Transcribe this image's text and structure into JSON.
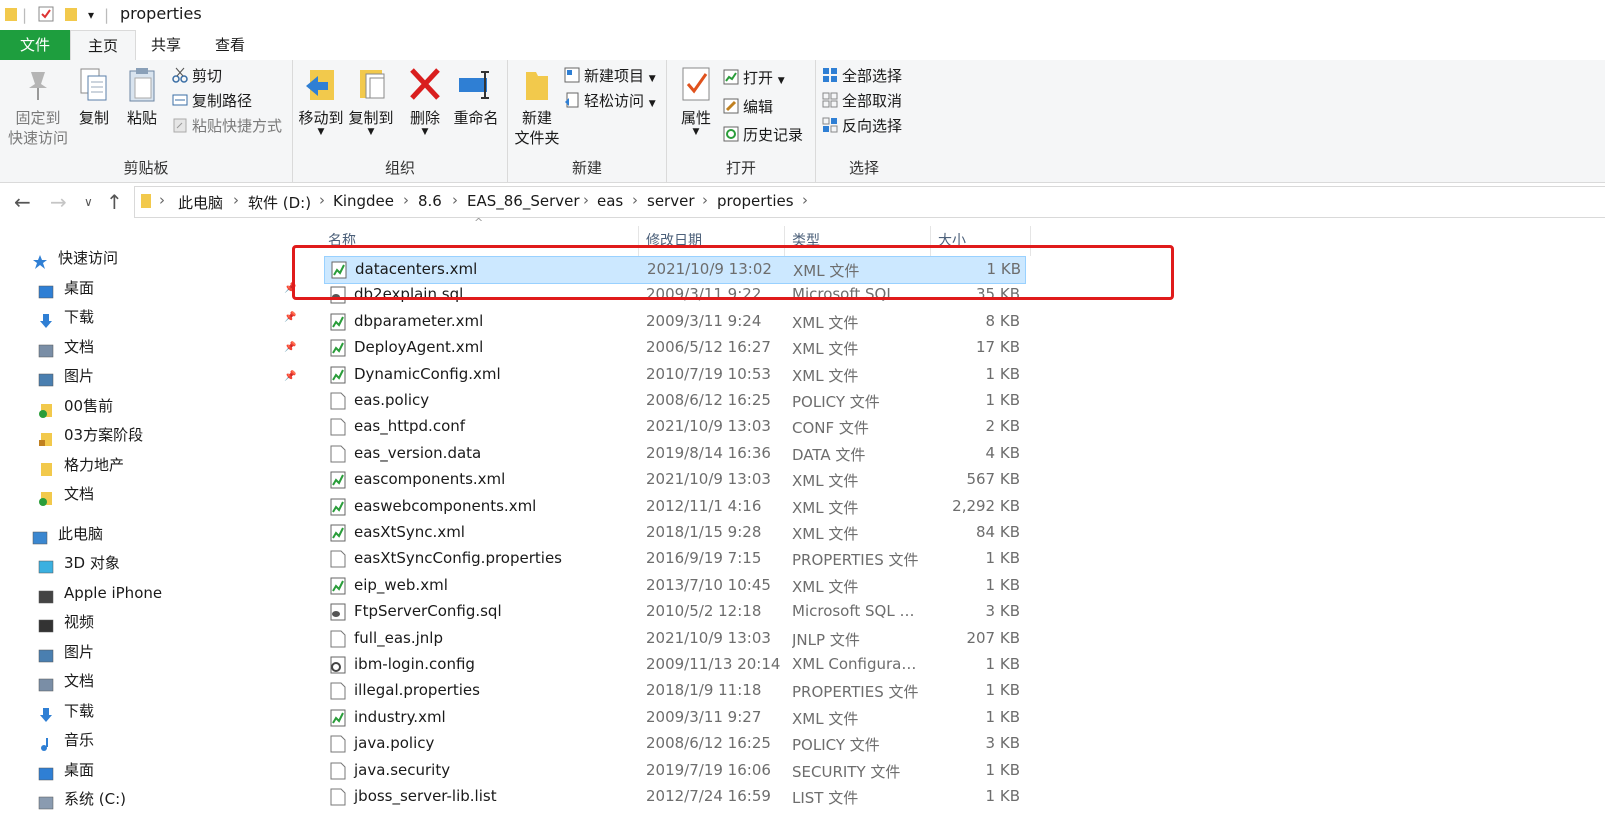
{
  "window": {
    "title": "properties"
  },
  "tabs": {
    "file": "文件",
    "home": "主页",
    "share": "共享",
    "view": "查看"
  },
  "ribbon": {
    "clipboard": {
      "label": "剪贴板",
      "pin": "固定到\n快速访问",
      "copy": "复制",
      "paste": "粘贴",
      "cut": "剪切",
      "copy_path": "复制路径",
      "paste_shortcut": "粘贴快捷方式"
    },
    "organize": {
      "label": "组织",
      "move_to": "移动到",
      "copy_to": "复制到",
      "delete": "删除",
      "rename": "重命名"
    },
    "new": {
      "label": "新建",
      "new_folder": "新建\n文件夹",
      "new_item": "新建项目",
      "easy_access": "轻松访问"
    },
    "open": {
      "label": "打开",
      "properties": "属性",
      "open": "打开",
      "edit": "编辑",
      "history": "历史记录"
    },
    "select": {
      "label": "选择",
      "select_all": "全部选择",
      "select_none": "全部取消",
      "invert": "反向选择"
    }
  },
  "address": {
    "crumbs": [
      "此电脑",
      "软件 (D:)",
      "Kingdee",
      "8.6",
      "EAS_86_Server",
      "eas",
      "server",
      "properties"
    ]
  },
  "nav": {
    "items": [
      {
        "label": "快速访问",
        "icon": "star-icon",
        "indent": 0,
        "pinned": false
      },
      {
        "label": "桌面",
        "icon": "desktop-icon",
        "indent": 1,
        "pinned": true
      },
      {
        "label": "下载",
        "icon": "download-icon",
        "indent": 1,
        "pinned": true
      },
      {
        "label": "文档",
        "icon": "document-icon",
        "indent": 1,
        "pinned": true
      },
      {
        "label": "图片",
        "icon": "picture-icon",
        "indent": 1,
        "pinned": true
      },
      {
        "label": "00售前",
        "icon": "synced-folder-icon",
        "indent": 1,
        "pinned": false
      },
      {
        "label": "03方案阶段",
        "icon": "lock-folder-icon",
        "indent": 1,
        "pinned": false
      },
      {
        "label": "格力地产",
        "icon": "folder-icon",
        "indent": 1,
        "pinned": false
      },
      {
        "label": "文档",
        "icon": "synced-folder-icon",
        "indent": 1,
        "pinned": false
      },
      {
        "label": "此电脑",
        "icon": "computer-icon",
        "indent": 0,
        "pinned": false
      },
      {
        "label": "3D 对象",
        "icon": "3d-objects-icon",
        "indent": 1,
        "pinned": false
      },
      {
        "label": "Apple iPhone",
        "icon": "phone-icon",
        "indent": 1,
        "pinned": false
      },
      {
        "label": "视频",
        "icon": "video-icon",
        "indent": 1,
        "pinned": false
      },
      {
        "label": "图片",
        "icon": "picture-icon",
        "indent": 1,
        "pinned": false
      },
      {
        "label": "文档",
        "icon": "document-icon",
        "indent": 1,
        "pinned": false
      },
      {
        "label": "下载",
        "icon": "download-icon",
        "indent": 1,
        "pinned": false
      },
      {
        "label": "音乐",
        "icon": "music-icon",
        "indent": 1,
        "pinned": false
      },
      {
        "label": "桌面",
        "icon": "desktop-icon",
        "indent": 1,
        "pinned": false
      },
      {
        "label": "系统 (C:)",
        "icon": "drive-icon",
        "indent": 1,
        "pinned": false
      }
    ]
  },
  "columns": {
    "name": "名称",
    "date": "修改日期",
    "type": "类型",
    "size": "大小"
  },
  "files": [
    {
      "name": "datacenters.xml",
      "date": "2021/10/9 13:02",
      "type": "XML 文件",
      "size": "1 KB",
      "kind": "xml",
      "selected": true
    },
    {
      "name": "db2explain.sql",
      "date": "2009/3/11 9:22",
      "type": "Microsoft SQL S...",
      "size": "35 KB",
      "kind": "sql"
    },
    {
      "name": "dbparameter.xml",
      "date": "2009/3/11 9:24",
      "type": "XML 文件",
      "size": "8 KB",
      "kind": "xml"
    },
    {
      "name": "DeployAgent.xml",
      "date": "2006/5/12 16:27",
      "type": "XML 文件",
      "size": "17 KB",
      "kind": "xml"
    },
    {
      "name": "DynamicConfig.xml",
      "date": "2010/7/19 10:53",
      "type": "XML 文件",
      "size": "1 KB",
      "kind": "xml"
    },
    {
      "name": "eas.policy",
      "date": "2008/6/12 16:25",
      "type": "POLICY 文件",
      "size": "1 KB",
      "kind": "file"
    },
    {
      "name": "eas_httpd.conf",
      "date": "2021/10/9 13:03",
      "type": "CONF 文件",
      "size": "2 KB",
      "kind": "file"
    },
    {
      "name": "eas_version.data",
      "date": "2019/8/14 16:36",
      "type": "DATA 文件",
      "size": "4 KB",
      "kind": "file"
    },
    {
      "name": "eascomponents.xml",
      "date": "2021/10/9 13:03",
      "type": "XML 文件",
      "size": "567 KB",
      "kind": "xml"
    },
    {
      "name": "easwebcomponents.xml",
      "date": "2012/11/1 4:16",
      "type": "XML 文件",
      "size": "2,292 KB",
      "kind": "xml"
    },
    {
      "name": "easXtSync.xml",
      "date": "2018/1/15 9:28",
      "type": "XML 文件",
      "size": "84 KB",
      "kind": "xml"
    },
    {
      "name": "easXtSyncConfig.properties",
      "date": "2016/9/19 7:15",
      "type": "PROPERTIES 文件",
      "size": "1 KB",
      "kind": "file"
    },
    {
      "name": "eip_web.xml",
      "date": "2013/7/10 10:45",
      "type": "XML 文件",
      "size": "1 KB",
      "kind": "xml"
    },
    {
      "name": "FtpServerConfig.sql",
      "date": "2010/5/2 12:18",
      "type": "Microsoft SQL S...",
      "size": "3 KB",
      "kind": "sql"
    },
    {
      "name": "full_eas.jnlp",
      "date": "2021/10/9 13:03",
      "type": "JNLP 文件",
      "size": "207 KB",
      "kind": "file"
    },
    {
      "name": "ibm-login.config",
      "date": "2009/11/13 20:14",
      "type": "XML Configurati...",
      "size": "1 KB",
      "kind": "config"
    },
    {
      "name": "illegal.properties",
      "date": "2018/1/9 11:18",
      "type": "PROPERTIES 文件",
      "size": "1 KB",
      "kind": "file"
    },
    {
      "name": "industry.xml",
      "date": "2009/3/11 9:27",
      "type": "XML 文件",
      "size": "1 KB",
      "kind": "xml"
    },
    {
      "name": "java.policy",
      "date": "2008/6/12 16:25",
      "type": "POLICY 文件",
      "size": "3 KB",
      "kind": "file"
    },
    {
      "name": "java.security",
      "date": "2019/7/19 16:06",
      "type": "SECURITY 文件",
      "size": "1 KB",
      "kind": "file"
    },
    {
      "name": "jboss_server-lib.list",
      "date": "2012/7/24 16:59",
      "type": "LIST 文件",
      "size": "1 KB",
      "kind": "file"
    }
  ],
  "colors": {
    "file_tab": "#1e9e3e",
    "selection": "#cce8ff",
    "highlight_box": "#e01b1b"
  }
}
